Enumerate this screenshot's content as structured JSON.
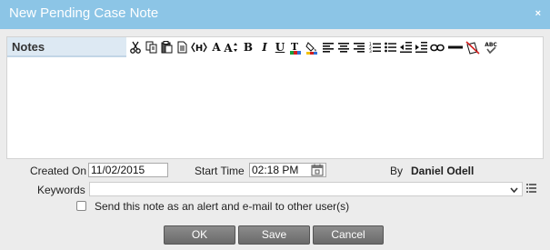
{
  "window": {
    "title": "New Pending Case Note",
    "close_glyph": "×"
  },
  "editor": {
    "tab_label": "Notes",
    "toolbar_icons": [
      "cut-icon",
      "copy-icon",
      "paste-icon",
      "paste-text-icon",
      "html-source-icon",
      "font-icon",
      "font-size-icon",
      "bold-icon",
      "italic-icon",
      "underline-icon",
      "text-color-icon",
      "highlight-icon",
      "align-left-icon",
      "align-center-icon",
      "align-right-icon",
      "ordered-list-icon",
      "unordered-list-icon",
      "outdent-icon",
      "indent-icon",
      "link-icon",
      "horizontal-rule-icon",
      "clear-format-icon",
      "spellcheck-icon"
    ],
    "content": ""
  },
  "form": {
    "created_on_label": "Created On",
    "created_on_value": "11/02/2015",
    "start_time_label": "Start Time",
    "start_time_value": "02:18 PM",
    "by_label": "By",
    "by_value": "Daniel Odell",
    "keywords_label": "Keywords",
    "keywords_value": "",
    "alert_checkbox_label": "Send this note as an alert and e-mail to other user(s)",
    "alert_checked": false
  },
  "buttons": {
    "ok": "OK",
    "save": "Save",
    "cancel": "Cancel"
  },
  "colors": {
    "titlebar": "#8cc5e6",
    "button": "#7a7a7a",
    "panel": "#ececec"
  }
}
